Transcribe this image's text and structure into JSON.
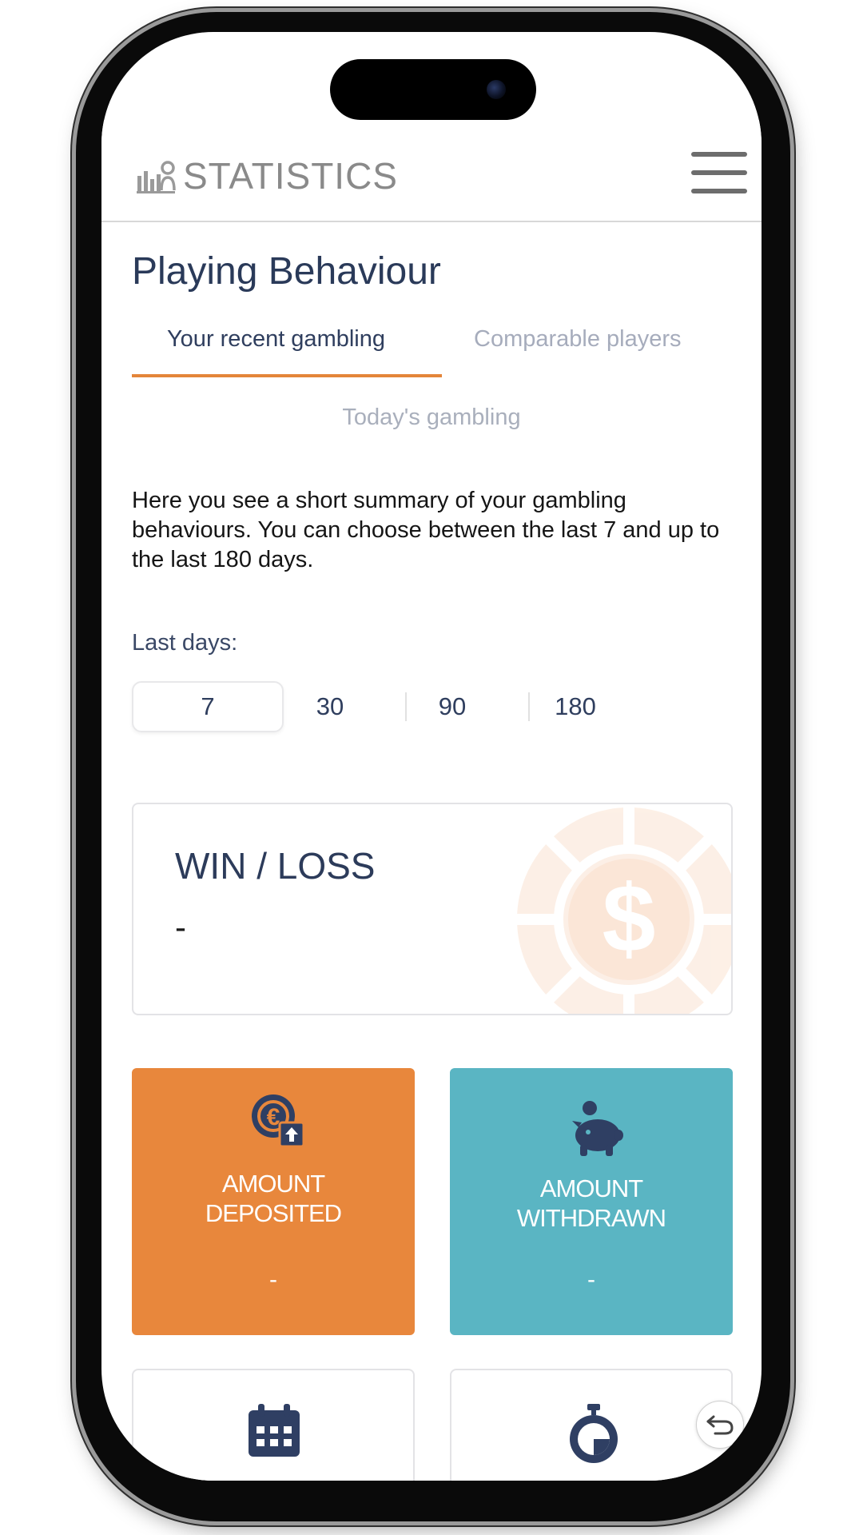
{
  "header": {
    "logo_text": "STATISTICS",
    "logo_icon": "bar-chart-user-icon",
    "menu_icon": "hamburger-icon"
  },
  "page": {
    "title": "Playing Behaviour",
    "tabs": [
      {
        "label": "Your recent gambling",
        "active": true
      },
      {
        "label": "Comparable players",
        "active": false
      }
    ],
    "subtab": "Today's gambling",
    "description": "Here you see a short summary of your gambling behaviours. You can choose between the last 7 and up to the last 180 days.",
    "days_label": "Last days:",
    "days_options": [
      "7",
      "30",
      "90",
      "180"
    ],
    "days_selected": "7"
  },
  "cards": {
    "win_loss": {
      "title": "WIN / LOSS",
      "value": "-",
      "icon": "casino-chip-dollar-icon"
    },
    "deposited": {
      "label_line1": "AMOUNT",
      "label_line2": "DEPOSITED",
      "value": "-",
      "icon": "coin-deposit-icon",
      "color": "#e8873c"
    },
    "withdrawn": {
      "label_line1": "AMOUNT",
      "label_line2": "WITHDRAWN",
      "value": "-",
      "icon": "piggy-bank-icon",
      "color": "#5ab5c3"
    },
    "calendar": {
      "icon": "calendar-icon"
    },
    "time": {
      "icon": "stopwatch-icon"
    }
  },
  "colors": {
    "accent": "#e4853a",
    "navy": "#2c3b5a",
    "muted": "#a6acbc"
  }
}
